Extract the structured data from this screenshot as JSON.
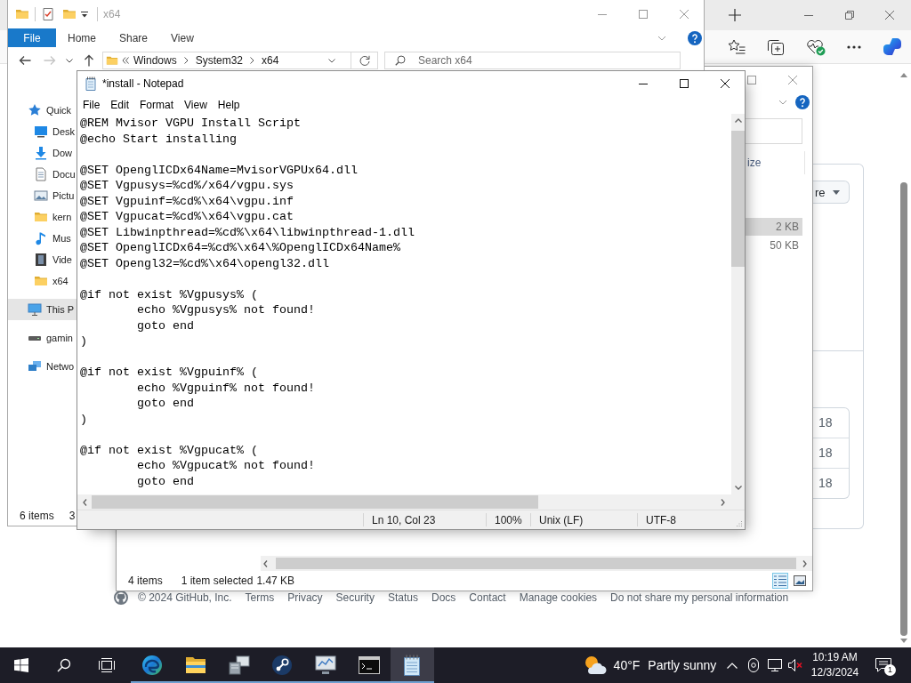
{
  "browser": {
    "card": {
      "button": "re",
      "rows": [
        "18",
        "18",
        "18"
      ]
    },
    "footer": {
      "copyright": "© 2024 GitHub, Inc.",
      "links": [
        "Terms",
        "Privacy",
        "Security",
        "Status",
        "Docs",
        "Contact",
        "Manage cookies",
        "Do not share my personal information"
      ]
    }
  },
  "explorer_2": {
    "column_header": "ize",
    "rows": [
      {
        "size": "2 KB",
        "selected": true
      },
      {
        "size": "50 KB",
        "selected": false
      }
    ],
    "status_bar": {
      "item_count": "4 items",
      "selection": "1 item selected",
      "size": "1.47 KB"
    },
    "views": [
      {
        "kind": "details",
        "selected": true
      },
      {
        "kind": "large_icons",
        "selected": false
      }
    ]
  },
  "explorer_x64": {
    "title": "x64",
    "ribbon_tabs": [
      {
        "label": "File",
        "kind": "menu"
      },
      {
        "label": "Home",
        "kind": "tab"
      },
      {
        "label": "Share",
        "kind": "tab"
      },
      {
        "label": "View",
        "kind": "tab"
      }
    ],
    "nav_buttons": [
      {
        "kind": "back",
        "disabled": false
      },
      {
        "kind": "forward",
        "disabled": true
      },
      {
        "kind": "recent",
        "disabled": false
      },
      {
        "kind": "up",
        "disabled": false
      }
    ],
    "address": [
      "Windows",
      "System32",
      "x64"
    ],
    "search": {
      "placeholder": "Search x64"
    },
    "sidebar": [
      {
        "label": "Quick",
        "kind": "star",
        "selected": false,
        "children": [
          {
            "label": "Desk",
            "kind": "desktop",
            "selected": false
          },
          {
            "label": "Dow",
            "kind": "download",
            "selected": false
          },
          {
            "label": "Docu",
            "kind": "document",
            "selected": false
          },
          {
            "label": "Pictu",
            "kind": "picture",
            "selected": false
          },
          {
            "label": "kern",
            "kind": "folder",
            "selected": false
          },
          {
            "label": "Mus",
            "kind": "music",
            "selected": false
          },
          {
            "label": "Vide",
            "kind": "video",
            "selected": false
          },
          {
            "label": "x64",
            "kind": "folder",
            "selected": false
          }
        ]
      },
      {
        "label": "This P",
        "kind": "computer",
        "selected": true
      },
      {
        "label": "gamin",
        "kind": "drive",
        "selected": false
      },
      {
        "label": "Netwo",
        "kind": "network",
        "selected": false
      }
    ],
    "status_bar": {
      "item_count": "6 items",
      "selection": "3"
    }
  },
  "notepad": {
    "title": "*install - Notepad",
    "menu": [
      "File",
      "Edit",
      "Format",
      "View",
      "Help"
    ],
    "blocks": [
      [
        "@REM Mvisor VGPU Install Script",
        "@echo Start installing"
      ],
      [
        "@SET OpenglICDx64Name=MvisorVGPUx64.dll",
        "@SET Vgpusys=%cd%/x64/vgpu.sys",
        "@SET Vgpuinf=%cd%\\x64\\vgpu.inf",
        "@SET Vgpucat=%cd%\\x64\\vgpu.cat",
        "@SET Libwinpthread=%cd%\\x64\\libwinpthread-1.dll",
        "@SET OpenglICDx64=%cd%\\x64\\%OpenglICDx64Name%",
        "@SET Opengl32=%cd%\\x64\\opengl32.dll"
      ],
      [
        "@if not exist %Vgpusys% (",
        "        echo %Vgpusys% not found!",
        "        goto end",
        ")"
      ],
      [
        "@if not exist %Vgpuinf% (",
        "        echo %Vgpuinf% not found!",
        "        goto end",
        ")"
      ],
      [
        "@if not exist %Vgpucat% (",
        "        echo %Vgpucat% not found!",
        "        goto end"
      ]
    ],
    "status_bar": {
      "position": "Ln 10, Col 23",
      "zoom": "100%",
      "line_ending": "Unix (LF)",
      "encoding": "UTF-8"
    }
  },
  "taskbar": {
    "apps": [
      {
        "kind": "browser",
        "running": true,
        "selected": false
      },
      {
        "kind": "files",
        "running": true,
        "selected": false
      },
      {
        "kind": "computer",
        "running": true,
        "selected": false
      },
      {
        "kind": "round_logo",
        "running": true,
        "selected": false
      },
      {
        "kind": "monitor",
        "running": true,
        "selected": false
      },
      {
        "kind": "terminal",
        "running": true,
        "selected": false
      },
      {
        "kind": "notepad",
        "running": true,
        "selected": true
      }
    ],
    "weather": {
      "temperature": "40°F",
      "condition": "Partly sunny"
    },
    "volume": {
      "muted": true
    },
    "clock": {
      "time": "10:19 AM",
      "date": "12/3/2024"
    },
    "notifications": {
      "count": "1"
    }
  }
}
